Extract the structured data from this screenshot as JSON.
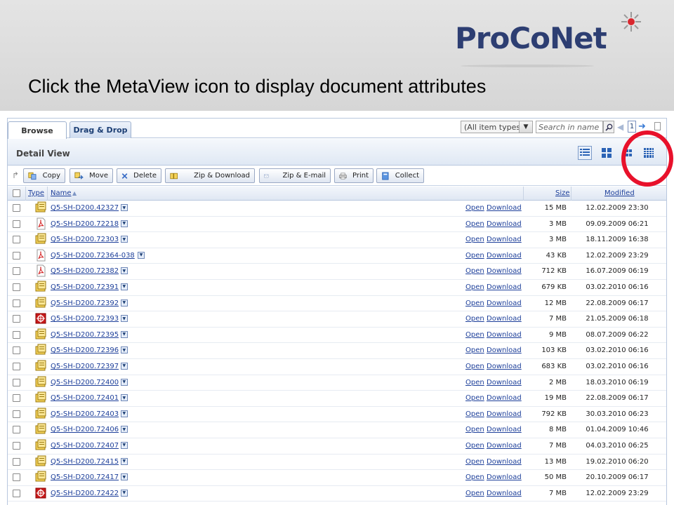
{
  "slide": {
    "logo_text": "ProCoNet",
    "title": "Click the MetaView icon to display document attributes"
  },
  "colors": {
    "highlight": "#e8112b",
    "link": "#1d3f9a",
    "logo": "#2d3e72",
    "logo_star": "#d9272e"
  },
  "tabs": [
    {
      "label": "Browse",
      "active": true
    },
    {
      "label": "Drag & Drop",
      "active": false
    }
  ],
  "filter": {
    "value": "(All item types)"
  },
  "search": {
    "placeholder": "Search in name"
  },
  "pager": {
    "page": "1"
  },
  "view": {
    "title": "Detail View",
    "modes": [
      "detail-view-icon",
      "thumbnail-view-icon",
      "small-icon-view-icon",
      "metaview-icon"
    ],
    "active_mode": "detail-view-icon"
  },
  "toolbar": {
    "copy": "Copy",
    "move": "Move",
    "delete": "Delete",
    "zip_download": "Zip & Download",
    "zip_email": "Zip & E-mail",
    "print": "Print",
    "collect": "Collect"
  },
  "columns": {
    "type": "Type",
    "name": "Name",
    "size": "Size",
    "modified": "Modified"
  },
  "actions": {
    "open": "Open",
    "download": "Download"
  },
  "rows": [
    {
      "type": "folder",
      "name": "Q5-SH-D200.42327",
      "size": "15 MB",
      "modified": "12.02.2009 23:30"
    },
    {
      "type": "pdf",
      "name": "Q5-SH-D200.72218",
      "size": "3 MB",
      "modified": "09.09.2009 06:21"
    },
    {
      "type": "folder",
      "name": "Q5-SH-D200.72303",
      "size": "3 MB",
      "modified": "18.11.2009 16:38"
    },
    {
      "type": "pdf",
      "name": "Q5-SH-D200.72364-038",
      "size": "43 KB",
      "modified": "12.02.2009 23:29"
    },
    {
      "type": "pdf",
      "name": "Q5-SH-D200.72382",
      "size": "712 KB",
      "modified": "16.07.2009 06:19"
    },
    {
      "type": "folder",
      "name": "Q5-SH-D200.72391",
      "size": "679 KB",
      "modified": "03.02.2010 06:16"
    },
    {
      "type": "folder",
      "name": "Q5-SH-D200.72392",
      "size": "12 MB",
      "modified": "22.08.2009 06:17"
    },
    {
      "type": "cad",
      "name": "Q5-SH-D200.72393",
      "size": "7 MB",
      "modified": "21.05.2009 06:18"
    },
    {
      "type": "folder",
      "name": "Q5-SH-D200.72395",
      "size": "9 MB",
      "modified": "08.07.2009 06:22"
    },
    {
      "type": "folder",
      "name": "Q5-SH-D200.72396",
      "size": "103 KB",
      "modified": "03.02.2010 06:16"
    },
    {
      "type": "folder",
      "name": "Q5-SH-D200.72397",
      "size": "683 KB",
      "modified": "03.02.2010 06:16"
    },
    {
      "type": "folder",
      "name": "Q5-SH-D200.72400",
      "size": "2 MB",
      "modified": "18.03.2010 06:19"
    },
    {
      "type": "folder",
      "name": "Q5-SH-D200.72401",
      "size": "19 MB",
      "modified": "22.08.2009 06:17"
    },
    {
      "type": "folder",
      "name": "Q5-SH-D200.72403",
      "size": "792 KB",
      "modified": "30.03.2010 06:23"
    },
    {
      "type": "folder",
      "name": "Q5-SH-D200.72406",
      "size": "8 MB",
      "modified": "01.04.2009 10:46"
    },
    {
      "type": "folder",
      "name": "Q5-SH-D200.72407",
      "size": "7 MB",
      "modified": "04.03.2010 06:25"
    },
    {
      "type": "folder",
      "name": "Q5-SH-D200.72415",
      "size": "13 MB",
      "modified": "19.02.2010 06:20"
    },
    {
      "type": "folder",
      "name": "Q5-SH-D200.72417",
      "size": "50 MB",
      "modified": "20.10.2009 06:17"
    },
    {
      "type": "cad",
      "name": "Q5-SH-D200.72422",
      "size": "7 MB",
      "modified": "12.02.2009 23:29"
    }
  ]
}
